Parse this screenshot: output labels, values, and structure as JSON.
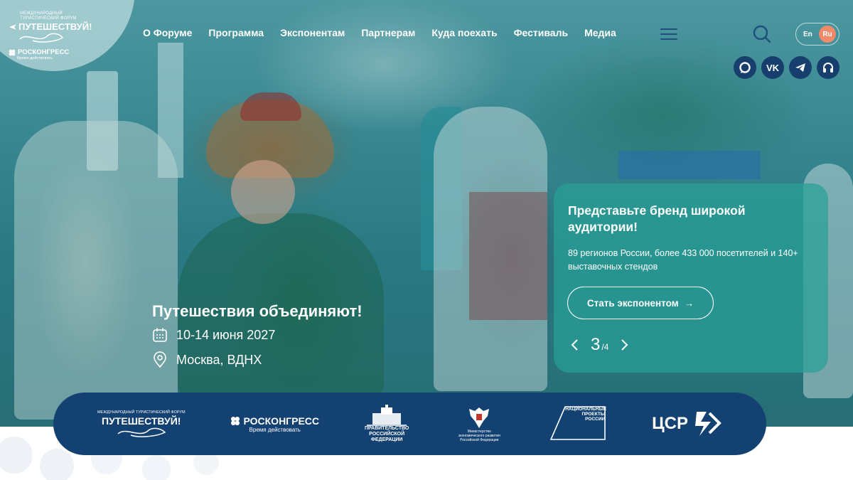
{
  "header": {
    "logo": {
      "forum_small": "Международный туристический форум",
      "forum_name": "ПУТЕШЕСТВУЙ!",
      "org_name": "РОСКОНГРЕСС",
      "org_sub": "Время действовать"
    },
    "nav": [
      {
        "label": "О Форуме"
      },
      {
        "label": "Программа"
      },
      {
        "label": "Экспонентам"
      },
      {
        "label": "Партнерам"
      },
      {
        "label": "Куда поехать"
      },
      {
        "label": "Фестиваль"
      },
      {
        "label": "Медиа"
      }
    ],
    "lang": {
      "en": "En",
      "ru": "Ru",
      "active": "Ru"
    },
    "socials": [
      "max-icon",
      "vk-icon",
      "telegram-icon",
      "headphones-icon"
    ],
    "vk_label": "VK"
  },
  "hero": {
    "title": "Путешествия объединяют!",
    "date": "10-14 июня 2027",
    "place": "Москва, ВДНХ"
  },
  "promo": {
    "title": "Представьте бренд широкой аудитории!",
    "text": "89 регионов России, более 433 000 посетителей и 140+ выставочных стендов",
    "button": "Стать экспонентом",
    "button_arrow": "→",
    "page_current": "3",
    "page_total": "/4"
  },
  "partners": {
    "forum": {
      "small": "Международный туристический форум",
      "name": "ПУТЕШЕСТВУЙ!"
    },
    "roscongress": {
      "name": "РОСКОНГРЕСС",
      "sub": "Время действовать"
    },
    "government": {
      "line1": "Правительство",
      "line2": "Российской",
      "line3": "Федерации"
    },
    "ministry": {
      "text": "Министерство экономического развития Российской Федерации"
    },
    "national_projects": {
      "text": "Национальные проекты России"
    },
    "csr": {
      "name": "ЦСР"
    }
  },
  "colors": {
    "brand_navy": "#124172",
    "accent_coral": "#f08a6a",
    "card_teal": "#28a096"
  }
}
